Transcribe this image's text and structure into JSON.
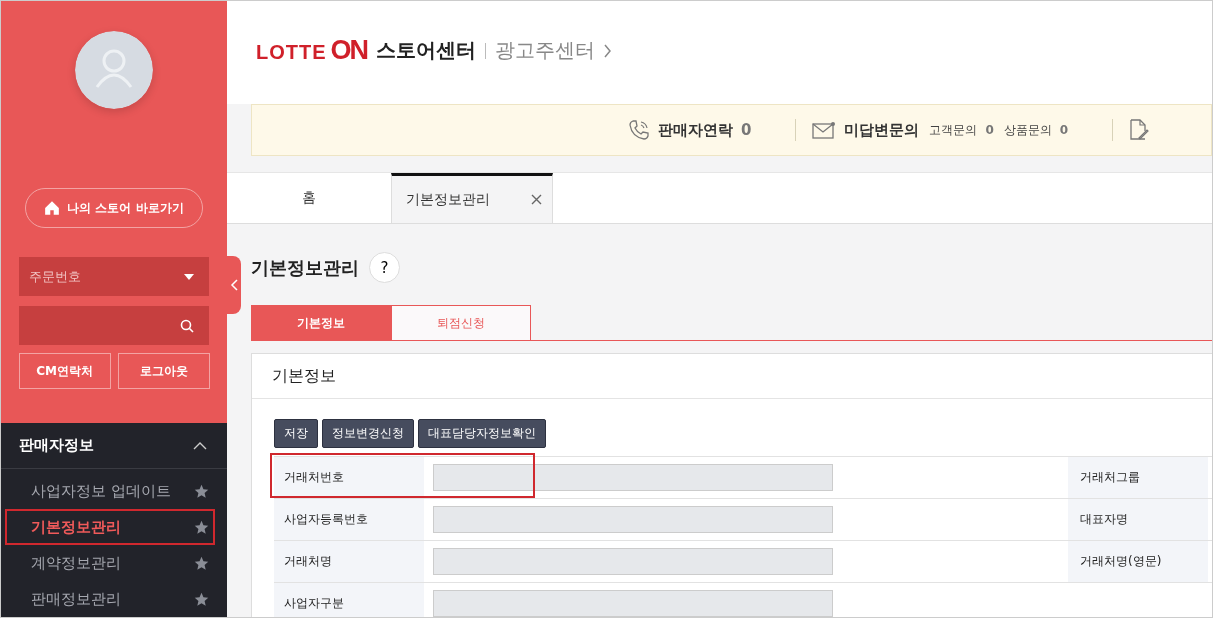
{
  "sidebar": {
    "home_button": "나의 스토어 바로가기",
    "search_type": {
      "value": "주문번호"
    },
    "buttons": [
      "CM연락처",
      "로그아웃"
    ],
    "section": {
      "title": "판매자정보",
      "expanded": true,
      "items": [
        {
          "label": "사업자정보 업데이트",
          "selected": false,
          "highlighted": false
        },
        {
          "label": "기본정보관리",
          "selected": true,
          "highlighted": true
        },
        {
          "label": "계약정보관리",
          "selected": false,
          "highlighted": false
        },
        {
          "label": "판매정보관리",
          "selected": false,
          "highlighted": false
        }
      ]
    }
  },
  "header": {
    "logo_left": "LOTTE",
    "logo_right": "ON",
    "title": "스토어센터",
    "link": "광고주센터"
  },
  "notice_bar": [
    {
      "kind": "phone",
      "label": "판매자연락",
      "count": "0"
    },
    {
      "kind": "mail",
      "label": "미답변문의",
      "subs": [
        {
          "label": "고객문의",
          "count": "0"
        },
        {
          "label": "상품문의",
          "count": "0"
        }
      ]
    },
    {
      "kind": "doc"
    }
  ],
  "page_tabs": [
    {
      "label": "홈",
      "selected": false,
      "closable": false
    },
    {
      "label": "기본정보관리",
      "selected": true,
      "closable": true
    }
  ],
  "page": {
    "title": "기본정보관리",
    "help": "?",
    "sub_tabs": [
      {
        "label": "기본정보",
        "selected": true
      },
      {
        "label": "퇴점신청",
        "selected": false
      }
    ],
    "panel_title": "기본정보",
    "actions": [
      "저장",
      "정보변경신청",
      "대표담당자정보확인"
    ],
    "rows": [
      {
        "label": "거래처번호",
        "right_label": "거래처그룹",
        "highlighted": true
      },
      {
        "label": "사업자등록번호",
        "right_label": "대표자명",
        "highlighted": false
      },
      {
        "label": "거래처명",
        "right_label": "거래처명(영문)",
        "highlighted": false
      },
      {
        "label": "사업자구분",
        "highlighted": false
      }
    ]
  }
}
